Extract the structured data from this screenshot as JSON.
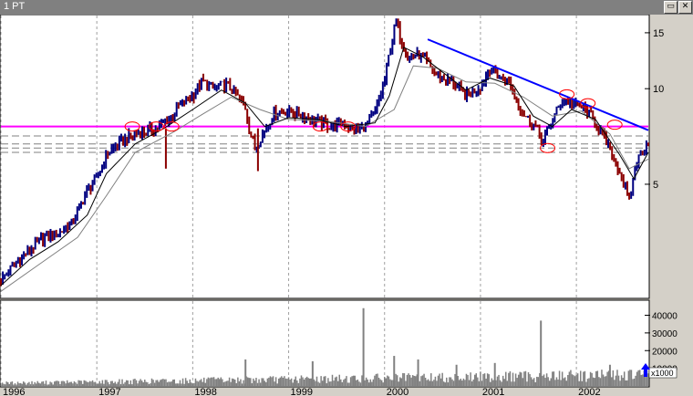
{
  "window": {
    "title": "1 PT",
    "minimize_icon": "minimize-icon",
    "close_icon": "close-icon",
    "minimize_glyph": "▭",
    "close_glyph": "✕"
  },
  "volume_multiplier_label": "x1000",
  "colors": {
    "background": "#ffffff",
    "price_up": "#000080",
    "price_down": "#8b0000",
    "moving_average_fast": "#000000",
    "moving_average_slow": "#808080",
    "trendline": "#0000ff",
    "support_line": "#ff00ff",
    "volume": "#808080",
    "grid": "#a0a0a0"
  },
  "chart_data": [
    {
      "type": "line",
      "scale": "log",
      "ylim": [
        2.2,
        17
      ],
      "xlim": [
        1996.0,
        2002.75
      ],
      "y_ticks": [
        5,
        10,
        15
      ],
      "x_ticks": [
        {
          "value": 1996,
          "label": "1996"
        },
        {
          "value": 1997,
          "label": "1997"
        },
        {
          "value": 1998,
          "label": "1998"
        },
        {
          "value": 1999,
          "label": "1999"
        },
        {
          "value": 2000,
          "label": "2000"
        },
        {
          "value": 2001,
          "label": "2001"
        },
        {
          "value": 2002,
          "label": "2002"
        }
      ],
      "grid": "vertical dashed at year boundaries",
      "price": {
        "x": [
          1996.0,
          1996.15,
          1996.3,
          1996.45,
          1996.6,
          1996.75,
          1996.9,
          1997.0,
          1997.1,
          1997.25,
          1997.4,
          1997.55,
          1997.65,
          1997.75,
          1997.85,
          1998.0,
          1998.1,
          1998.2,
          1998.35,
          1998.45,
          1998.55,
          1998.6,
          1998.65,
          1998.75,
          1998.85,
          1999.0,
          1999.15,
          1999.3,
          1999.45,
          1999.55,
          1999.7,
          1999.8,
          1999.9,
          2000.0,
          2000.05,
          2000.12,
          2000.18,
          2000.25,
          2000.35,
          2000.45,
          2000.55,
          2000.7,
          2000.85,
          2001.0,
          2001.1,
          2001.2,
          2001.3,
          2001.42,
          2001.5,
          2001.58,
          2001.65,
          2001.75,
          2001.85,
          2001.95,
          2002.05,
          2002.15,
          2002.25,
          2002.35,
          2002.45,
          2002.55,
          2002.62,
          2002.7,
          2002.75
        ],
        "y": [
          2.5,
          2.8,
          3.1,
          3.4,
          3.5,
          3.8,
          4.8,
          5.2,
          6.2,
          6.8,
          7.2,
          7.4,
          7.6,
          8.0,
          8.8,
          9.5,
          10.6,
          10.0,
          10.3,
          9.6,
          8.7,
          7.2,
          6.5,
          7.4,
          8.4,
          8.5,
          8.2,
          7.9,
          7.6,
          7.8,
          7.4,
          7.6,
          8.4,
          10.5,
          13.0,
          16.2,
          14.0,
          12.5,
          12.8,
          12.0,
          11.0,
          10.5,
          9.5,
          10.2,
          11.6,
          10.8,
          10.5,
          8.6,
          8.0,
          7.6,
          6.8,
          8.0,
          9.2,
          9.0,
          8.8,
          8.2,
          7.4,
          6.4,
          5.5,
          4.4,
          5.8,
          6.5,
          6.8
        ]
      },
      "moving_average_fast": {
        "x": [
          1996.0,
          1996.3,
          1996.6,
          1996.9,
          1997.1,
          1997.4,
          1997.7,
          1998.0,
          1998.3,
          1998.55,
          1998.75,
          1999.0,
          1999.3,
          1999.6,
          1999.9,
          2000.05,
          2000.2,
          2000.4,
          2000.6,
          2000.85,
          2001.1,
          2001.35,
          2001.55,
          2001.75,
          2001.95,
          2002.2,
          2002.45,
          2002.6,
          2002.75
        ],
        "y": [
          2.4,
          2.9,
          3.3,
          4.0,
          5.4,
          6.7,
          7.5,
          8.6,
          9.9,
          9.0,
          7.6,
          8.1,
          8.0,
          7.6,
          7.8,
          9.5,
          13.5,
          12.6,
          11.3,
          9.9,
          10.8,
          10.2,
          8.2,
          7.6,
          8.6,
          8.0,
          6.2,
          5.2,
          6.3
        ]
      },
      "moving_average_slow": {
        "x": [
          1996.0,
          1996.4,
          1996.8,
          1997.1,
          1997.4,
          1997.8,
          1998.1,
          1998.4,
          1998.7,
          1999.0,
          1999.4,
          1999.8,
          2000.1,
          2000.3,
          2000.55,
          2000.85,
          2001.15,
          2001.45,
          2001.75,
          2002.05,
          2002.35,
          2002.55,
          2002.75
        ],
        "y": [
          2.3,
          2.8,
          3.4,
          4.6,
          6.3,
          7.3,
          8.3,
          9.4,
          8.6,
          8.0,
          7.9,
          7.6,
          8.6,
          11.8,
          11.6,
          10.5,
          10.4,
          9.4,
          8.2,
          8.5,
          7.2,
          5.6,
          6.0
        ]
      },
      "trendline": {
        "x": [
          2000.45,
          2002.75
        ],
        "y": [
          14.3,
          7.4
        ]
      },
      "support_line": {
        "y": 7.6
      },
      "reference_lines_dashed": [
        7.1,
        6.7,
        6.5,
        6.3
      ],
      "marker_circles": [
        {
          "x": 1997.37,
          "y": 7.6
        },
        {
          "x": 1997.62,
          "y": 7.6
        },
        {
          "x": 1997.78,
          "y": 7.6
        },
        {
          "x": 1999.33,
          "y": 7.6
        },
        {
          "x": 1999.62,
          "y": 7.6
        },
        {
          "x": 2001.7,
          "y": 6.5
        },
        {
          "x": 2001.9,
          "y": 9.6
        },
        {
          "x": 2002.12,
          "y": 9.0
        },
        {
          "x": 2002.4,
          "y": 7.7
        }
      ]
    },
    {
      "type": "bar",
      "ylim": [
        0,
        48000
      ],
      "xlim": [
        1996.0,
        2002.75
      ],
      "y_ticks": [
        {
          "value": 10000,
          "label": "10000"
        },
        {
          "value": 20000,
          "label": "20000"
        },
        {
          "value": 30000,
          "label": "30000"
        },
        {
          "value": 40000,
          "label": "40000"
        }
      ],
      "volume_spikes": [
        {
          "x": 1998.55,
          "value": 15000
        },
        {
          "x": 1999.25,
          "value": 14000
        },
        {
          "x": 1999.78,
          "value": 44000
        },
        {
          "x": 2000.1,
          "value": 17000
        },
        {
          "x": 2000.35,
          "value": 15000
        },
        {
          "x": 2000.75,
          "value": 12000
        },
        {
          "x": 2001.15,
          "value": 13000
        },
        {
          "x": 2001.63,
          "value": 37000
        },
        {
          "x": 2002.35,
          "value": 12000
        }
      ]
    }
  ]
}
